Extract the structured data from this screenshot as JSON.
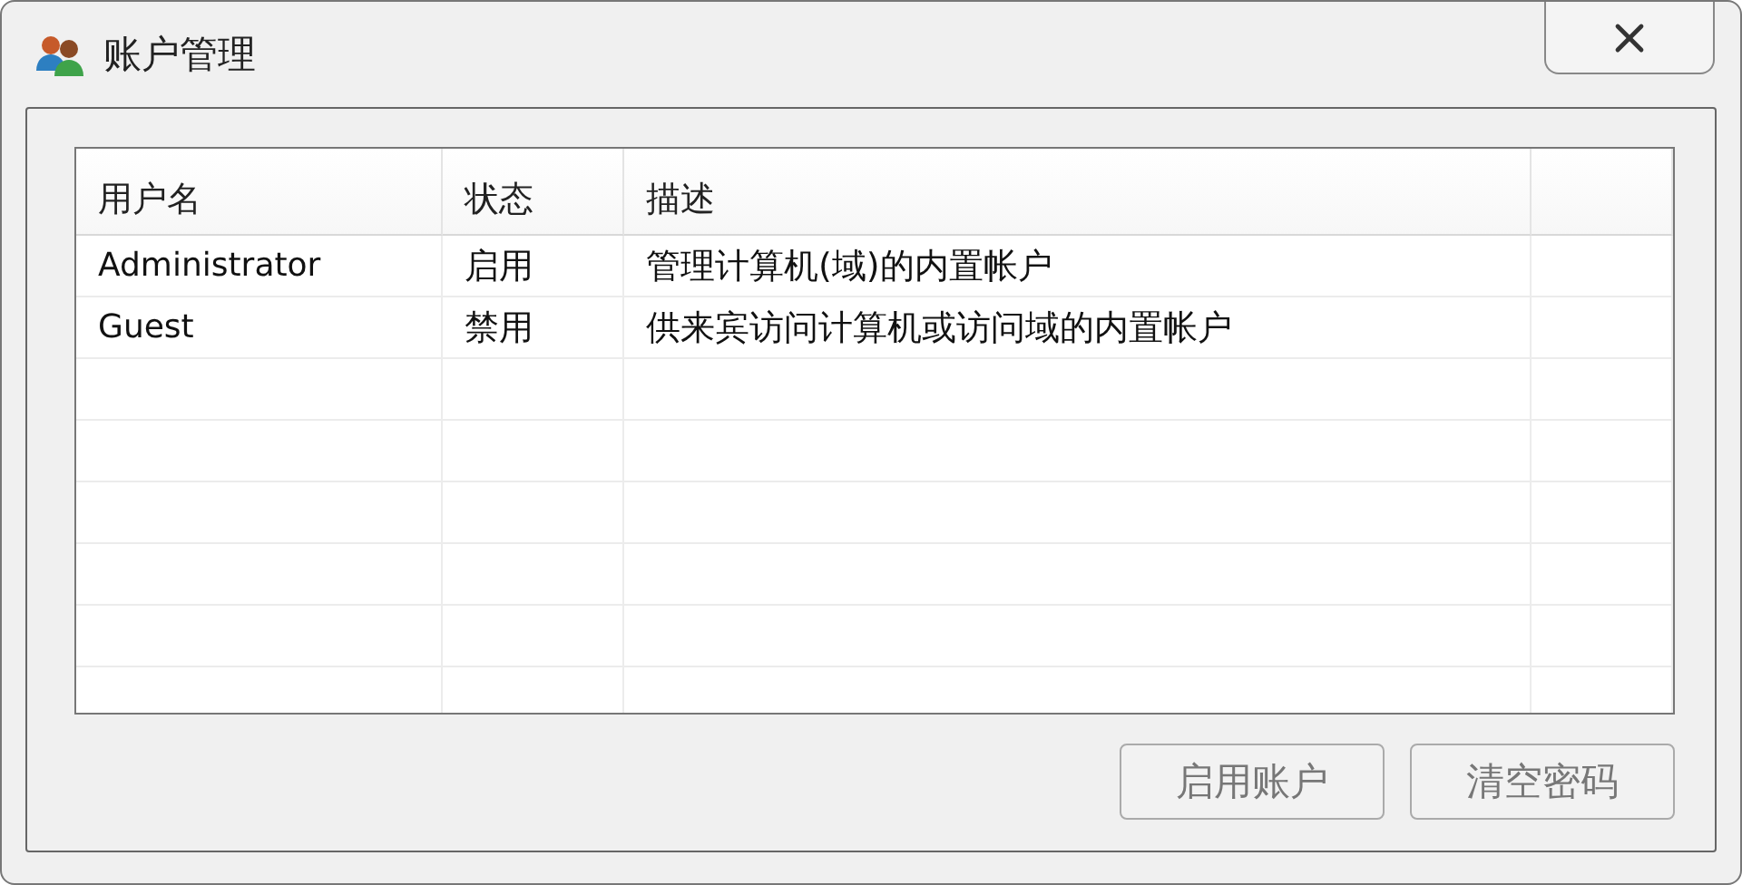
{
  "window": {
    "title": "账户管理"
  },
  "table": {
    "columns": [
      "用户名",
      "状态",
      "描述"
    ],
    "rows": [
      {
        "cells": [
          "Administrator",
          "启用",
          "管理计算机(域)的内置帐户"
        ]
      },
      {
        "cells": [
          "Guest",
          "禁用",
          "供来宾访问计算机或访问域的内置帐户"
        ]
      }
    ]
  },
  "buttons": [
    {
      "label": "启用账户",
      "disabled": true
    },
    {
      "label": "清空密码",
      "disabled": true
    }
  ]
}
